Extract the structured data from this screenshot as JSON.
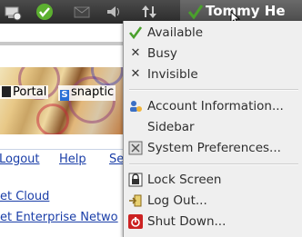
{
  "panel": {
    "user_name": "Tommy He",
    "icons": [
      "network-icon",
      "update-available-icon",
      "volume-icon",
      "network-transfer-icon",
      "status-available-icon"
    ]
  },
  "browser": {
    "bookmarks": [
      "Portal",
      "snaptic"
    ],
    "links": [
      "Logout",
      "Help",
      "Se"
    ],
    "list_links": [
      "et Cloud",
      "et Enterprise Netwo"
    ]
  },
  "menu": {
    "status": [
      {
        "label": "Available",
        "icon": "check-icon"
      },
      {
        "label": "Busy",
        "icon": "x-icon"
      },
      {
        "label": "Invisible",
        "icon": "x-icon"
      }
    ],
    "account": [
      {
        "label": "Account Information...",
        "icon": "account-icon"
      },
      {
        "label": "Sidebar",
        "icon": ""
      },
      {
        "label": "System Preferences...",
        "icon": "preferences-icon"
      }
    ],
    "session": [
      {
        "label": "Lock Screen",
        "icon": "lock-icon"
      },
      {
        "label": "Log Out...",
        "icon": "logout-icon"
      },
      {
        "label": "Shut Down...",
        "icon": "power-icon"
      }
    ]
  },
  "colors": {
    "panel": "#3a3a3a",
    "menu_bg": "#efefef",
    "check_green": "#4aa02c",
    "power_red": "#cc2222",
    "link_blue": "#1a3ea8"
  }
}
